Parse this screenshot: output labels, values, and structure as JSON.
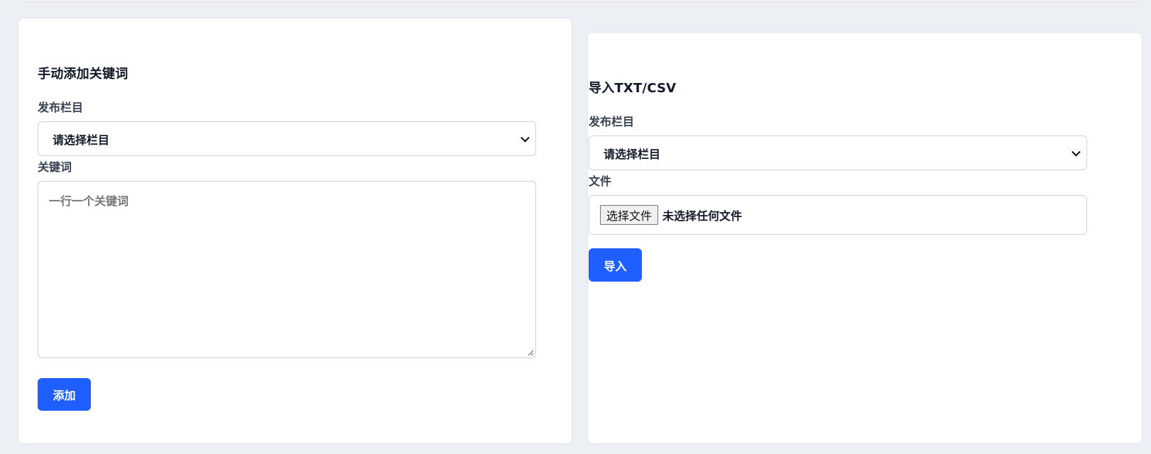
{
  "manual": {
    "title": "手动添加关键词",
    "category_label": "发布栏目",
    "category_select": "请选择栏目",
    "keywords_label": "关键词",
    "keywords_placeholder": "一行一个关键词",
    "add_button": "添加"
  },
  "import": {
    "title": "导入TXT/CSV",
    "category_label": "发布栏目",
    "category_select": "请选择栏目",
    "file_label": "文件",
    "file_button": "选择文件",
    "file_status": "未选择任何文件",
    "import_button": "导入"
  },
  "colors": {
    "accent": "#1f5eff",
    "background": "#eceff3",
    "card": "#ffffff"
  },
  "icons": [
    "chevron-down-icon",
    "resize-grip-icon"
  ]
}
